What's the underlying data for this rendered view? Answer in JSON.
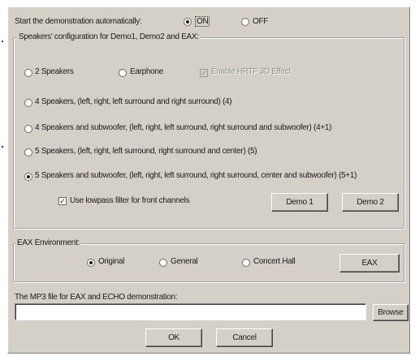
{
  "autostart": {
    "label": "Start the demonstration automatically:",
    "on_label": "ON",
    "off_label": "OFF",
    "selected": "ON"
  },
  "speakers": {
    "group_title": "Speakers' configuration for Demo1, Demo2 and EAX:",
    "options": [
      {
        "label": "2 Speakers",
        "selected": false
      },
      {
        "label": "Earphone",
        "selected": false
      },
      {
        "label": "4 Speakers, (left, right, left surround and right surround) (4)",
        "selected": false
      },
      {
        "label": "4 Speakers and subwoofer, (left, right, left surround, right surround and subwoofer) (4+1)",
        "selected": false
      },
      {
        "label": "5 Speakers, (left, right, left surround, right surround and center) (5)",
        "selected": false
      },
      {
        "label": "5 Speakers and subwoofer, (left, right, left surround, right surround, center and subwoofer) (5+1)",
        "selected": true
      }
    ],
    "hrtf_label": "Enable HRTF 3D Effect",
    "lowpass_label": "Use lowpass filter for front channels",
    "demo1_label": "Demo 1",
    "demo2_label": "Demo 2"
  },
  "eax": {
    "group_title": "EAX Environment:",
    "options": [
      {
        "label": "Original",
        "selected": true
      },
      {
        "label": "General",
        "selected": false
      },
      {
        "label": "Concert Hall",
        "selected": false
      }
    ],
    "button_label": "EAX"
  },
  "mp3": {
    "label": "The MP3 file for EAX and ECHO demonstration:",
    "value": "",
    "browse_label": "Browse"
  },
  "footer": {
    "ok_label": "OK",
    "cancel_label": "Cancel"
  }
}
